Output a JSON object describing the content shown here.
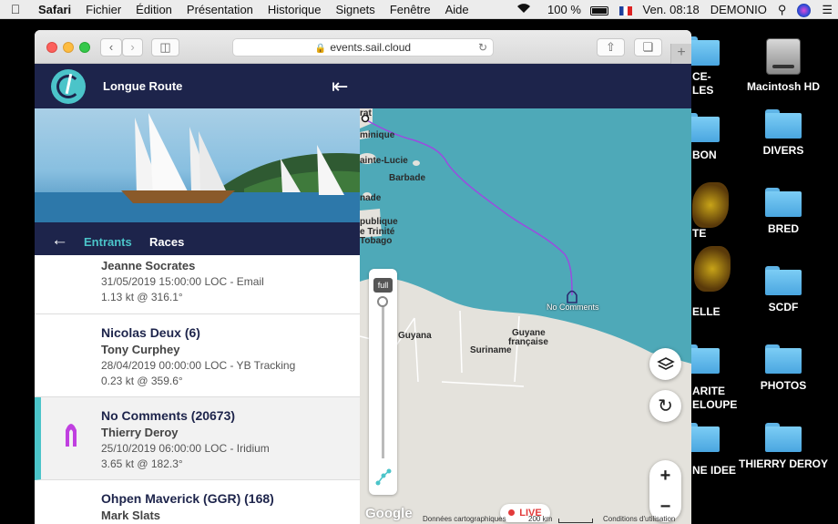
{
  "menubar": {
    "apple": "",
    "items": [
      "Safari",
      "Fichier",
      "Édition",
      "Présentation",
      "Historique",
      "Signets",
      "Fenêtre",
      "Aide"
    ],
    "battery": "100 %",
    "clock": "Ven. 08:18",
    "user": "DEMONIO"
  },
  "desktop": {
    "icons": [
      "Macintosh HD",
      "DIVERS",
      "BRED",
      "SCDF",
      "PHOTOS",
      "THIERRY DEROY"
    ],
    "partial_labels": [
      "CE-",
      "LES",
      "BON",
      "TE",
      "ELLE",
      "ARITE",
      "ELOUPE",
      "NE IDEE"
    ]
  },
  "browser": {
    "url": "events.sail.cloud"
  },
  "app": {
    "title": "Longue Route",
    "tabs": [
      "Entrants",
      "Races"
    ],
    "active_tab_color": "#4bc4c9"
  },
  "entries": [
    {
      "name": "",
      "skipper": "Jeanne Socrates",
      "position": "31/05/2019 15:00:00 LOC - Email",
      "speed": "1.13 kt @ 316.1°"
    },
    {
      "name": "Nicolas Deux (6)",
      "skipper": "Tony Curphey",
      "position": "28/04/2019 00:00:00 LOC - YB Tracking",
      "speed": "0.23 kt @ 359.6°"
    },
    {
      "name": "No Comments (20673)",
      "skipper": "Thierry Deroy",
      "position": "25/10/2019 06:00:00 LOC - Iridium",
      "speed": "3.65 kt @ 182.3°"
    },
    {
      "name": "Ohpen Maverick (GGR) (168)",
      "skipper": "Mark Slats",
      "position": "",
      "speed": ""
    }
  ],
  "map": {
    "labels": [
      "rat",
      "minique",
      "ainte-Lucie",
      "Barbade",
      "nade",
      "publique",
      "e Trinité",
      "Tobago",
      "Guyana",
      "Suriname",
      "Guyane",
      "française"
    ],
    "boat_label": "No Comments",
    "slider_label": "full",
    "live": "LIVE",
    "attribution": "Données cartographiques",
    "scale": "200 km",
    "terms": "Conditions d'utilisation",
    "google": "Google",
    "track_color": "#9b4be0"
  }
}
